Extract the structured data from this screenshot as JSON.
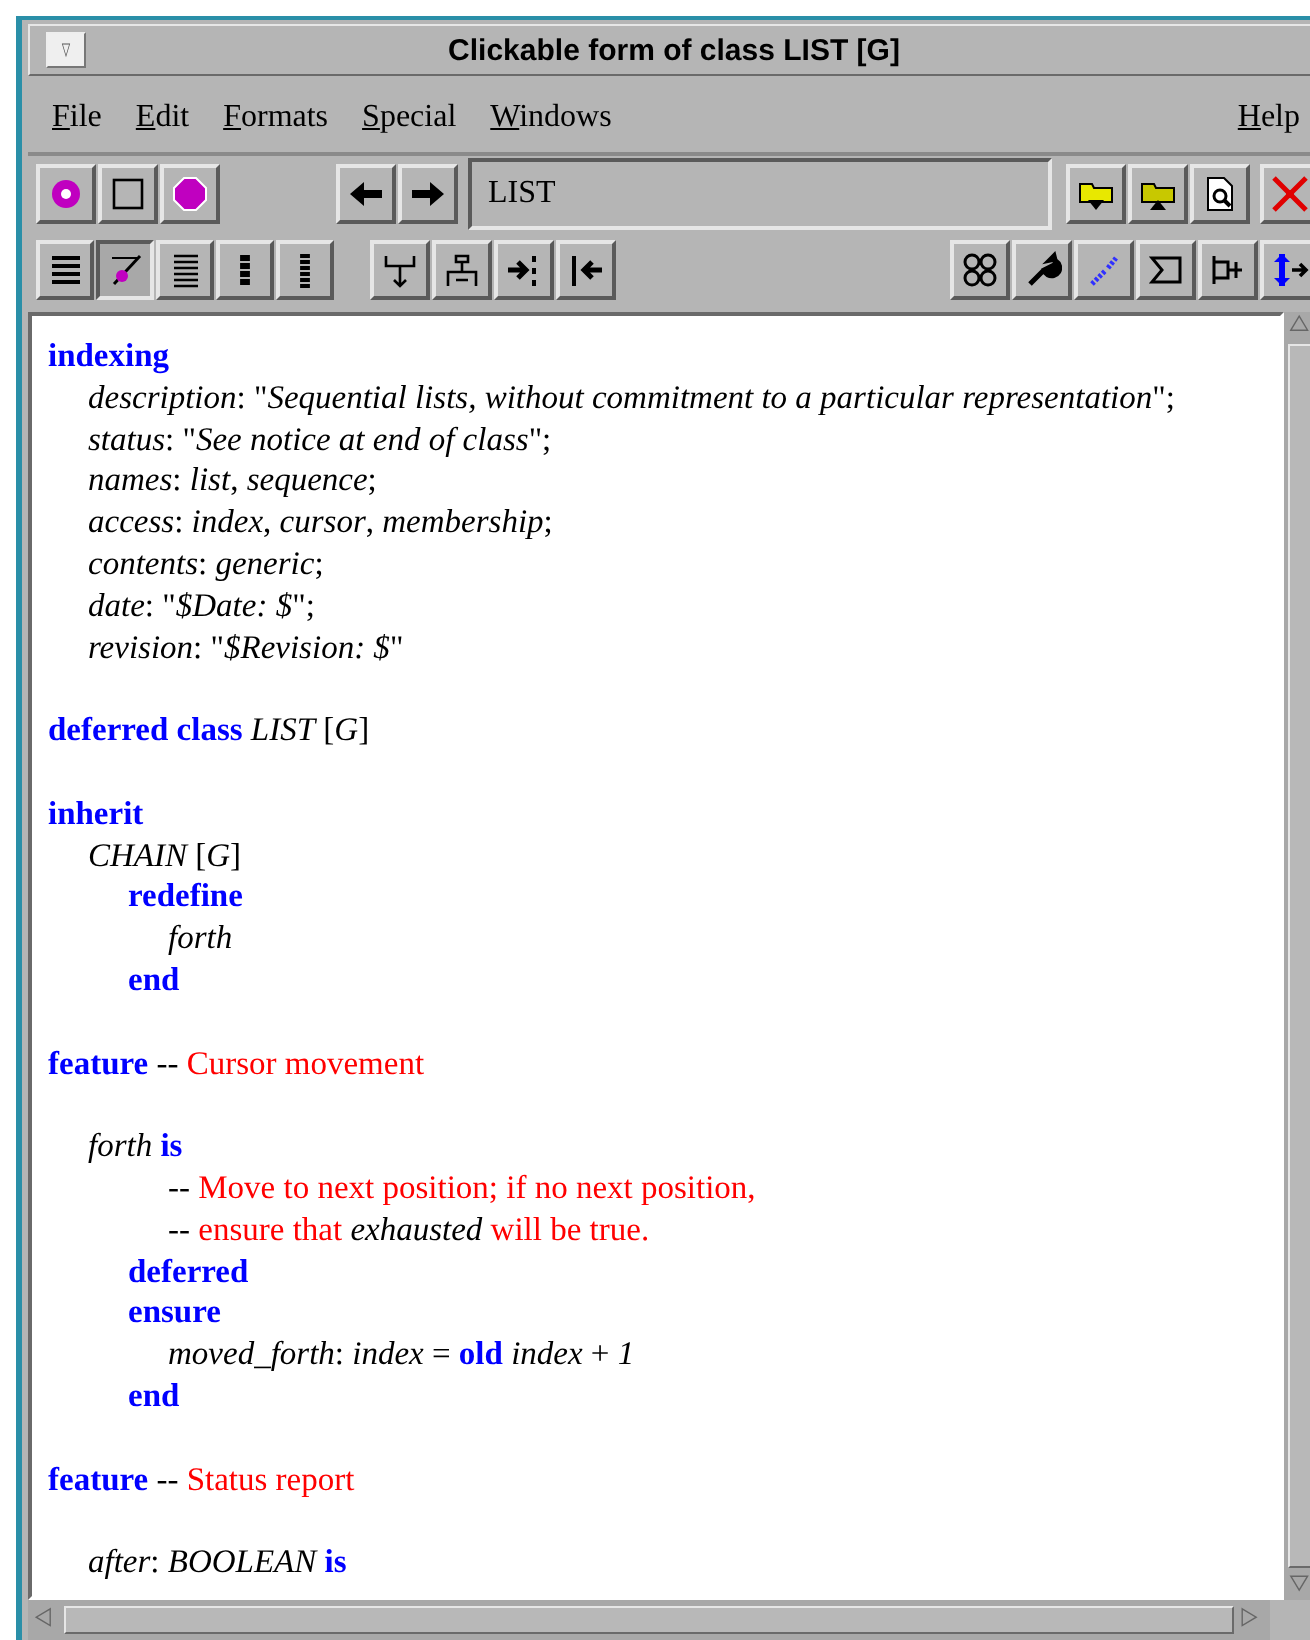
{
  "window": {
    "title": "Clickable form of class LIST [G]"
  },
  "menu": [
    {
      "label": "File"
    },
    {
      "label": "Edit"
    },
    {
      "label": "Formats"
    },
    {
      "label": "Special"
    },
    {
      "label": "Windows"
    },
    {
      "label": "Help"
    }
  ],
  "target_field": {
    "value": "LIST"
  },
  "format_buttons": [
    {
      "selected": false
    },
    {
      "selected": true
    },
    {
      "selected": false
    },
    {
      "selected": false
    },
    {
      "selected": false
    }
  ],
  "code": [
    {
      "kind": "code",
      "segments": [
        {
          "kind": "keyword",
          "text": "indexing"
        }
      ],
      "children": [
        {
          "kind": "code",
          "segments": [
            {
              "kind": "text",
              "text": "*description*: \"*Sequential lists, without commitment to a particular representation*\";"
            }
          ]
        },
        {
          "kind": "code",
          "segments": [
            {
              "kind": "text",
              "text": "*status*: \"*See notice at end of class*\";"
            }
          ]
        },
        {
          "kind": "code",
          "segments": [
            {
              "kind": "text",
              "text": "*names*: *list*, *sequence*;"
            }
          ]
        },
        {
          "kind": "code",
          "segments": [
            {
              "kind": "text",
              "text": "*access*: *index*, *cursor*, *membership*;"
            }
          ]
        },
        {
          "kind": "code",
          "segments": [
            {
              "kind": "text",
              "text": "*contents*: *generic*;"
            }
          ]
        },
        {
          "kind": "code",
          "segments": [
            {
              "kind": "text",
              "text": "*date*: \"*$Date: $*\";"
            }
          ]
        },
        {
          "kind": "code",
          "segments": [
            {
              "kind": "text",
              "text": "*revision*: \"*$Revision: $*\""
            }
          ]
        }
      ]
    },
    {
      "kind": "blank"
    },
    {
      "kind": "code",
      "segments": [
        {
          "kind": "keyword",
          "text": "deferred class"
        },
        {
          "kind": "text",
          "text": "*LIST* [*G*]"
        }
      ]
    },
    {
      "kind": "blank"
    },
    {
      "kind": "code",
      "segments": [
        {
          "kind": "keyword",
          "text": "inherit"
        }
      ],
      "children": [
        {
          "kind": "code",
          "segments": [
            {
              "kind": "text",
              "text": "*CHAIN* [*G*]"
            }
          ],
          "children": [
            {
              "kind": "code",
              "segments": [
                {
                  "kind": "keyword",
                  "text": "redefine"
                }
              ],
              "children": [
                {
                  "kind": "code",
                  "segments": [
                    {
                      "kind": "text",
                      "text": "*forth*"
                    }
                  ]
                }
              ]
            },
            {
              "kind": "code",
              "segments": [
                {
                  "kind": "keyword",
                  "text": "end"
                }
              ]
            }
          ]
        }
      ]
    },
    {
      "kind": "blank"
    },
    {
      "kind": "code",
      "segments": [
        {
          "kind": "keyword",
          "text": "feature"
        },
        {
          "kind": "text",
          "text": "--"
        },
        {
          "kind": "comment",
          "text": "Cursor movement"
        }
      ],
      "children": [
        {
          "kind": "blank"
        },
        {
          "kind": "code",
          "segments": [
            {
              "kind": "text",
              "text": "*forth*"
            },
            {
              "kind": "keyword",
              "text": "is"
            }
          ],
          "children": [
            {
              "kind": "group",
              "children": [
                {
                  "kind": "code",
                  "segments": [
                    {
                      "kind": "text",
                      "text": "--"
                    },
                    {
                      "kind": "comment",
                      "text": "Move to next position; if no next position,"
                    }
                  ]
                },
                {
                  "kind": "code",
                  "segments": [
                    {
                      "kind": "text",
                      "text": "--"
                    },
                    {
                      "kind": "comment",
                      "text": "ensure that"
                    },
                    {
                      "kind": "text",
                      "text": "*exhausted*"
                    },
                    {
                      "kind": "comment",
                      "text": "will be true."
                    }
                  ]
                }
              ]
            },
            {
              "kind": "code",
              "segments": [
                {
                  "kind": "keyword",
                  "text": "deferred"
                }
              ]
            },
            {
              "kind": "code",
              "segments": [
                {
                  "kind": "keyword",
                  "text": "ensure"
                }
              ],
              "children": [
                {
                  "kind": "code",
                  "segments": [
                    {
                      "kind": "text",
                      "text": "*moved_forth*: *index* ="
                    },
                    {
                      "kind": "keyword",
                      "text": "old"
                    },
                    {
                      "kind": "text",
                      "text": "*index* + *1*"
                    }
                  ]
                }
              ]
            },
            {
              "kind": "code",
              "segments": [
                {
                  "kind": "keyword",
                  "text": "end"
                }
              ]
            }
          ]
        },
        {
          "kind": "blank"
        }
      ]
    },
    {
      "kind": "code",
      "segments": [
        {
          "kind": "keyword",
          "text": "feature"
        },
        {
          "kind": "text",
          "text": "--"
        },
        {
          "kind": "comment",
          "text": "Status report"
        }
      ],
      "children": [
        {
          "kind": "blank"
        },
        {
          "kind": "code",
          "segments": [
            {
              "kind": "text",
              "text": "*after*: *BOOLEAN*"
            },
            {
              "kind": "keyword",
              "text": "is"
            }
          ]
        }
      ]
    }
  ]
}
